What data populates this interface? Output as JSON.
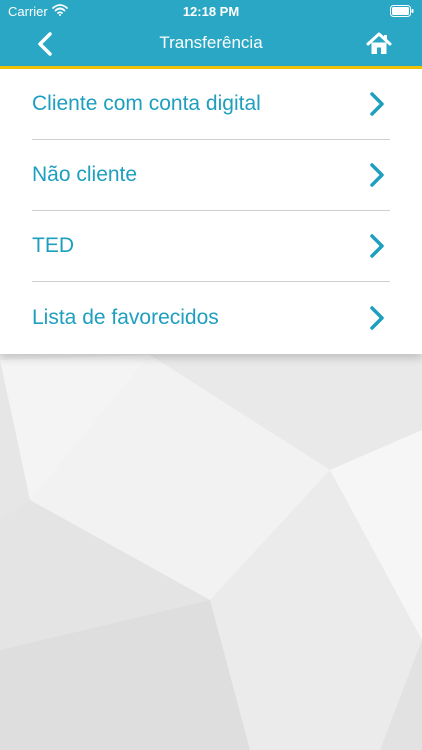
{
  "status_bar": {
    "carrier": "Carrier",
    "time": "12:18 PM"
  },
  "nav": {
    "title": "Transferência",
    "back_icon": "chevron-left-icon",
    "home_icon": "home-icon"
  },
  "menu": {
    "items": [
      {
        "label": "Cliente com conta digital",
        "icon": "chevron-right-icon"
      },
      {
        "label": "Não cliente",
        "icon": "chevron-right-icon"
      },
      {
        "label": "TED",
        "icon": "chevron-right-icon"
      },
      {
        "label": "Lista de favorecidos",
        "icon": "chevron-right-icon"
      }
    ]
  },
  "colors": {
    "header": "#2aa7c4",
    "accent": "#f2c500",
    "item_text": "#1e9fbf",
    "background": "#ececec"
  }
}
